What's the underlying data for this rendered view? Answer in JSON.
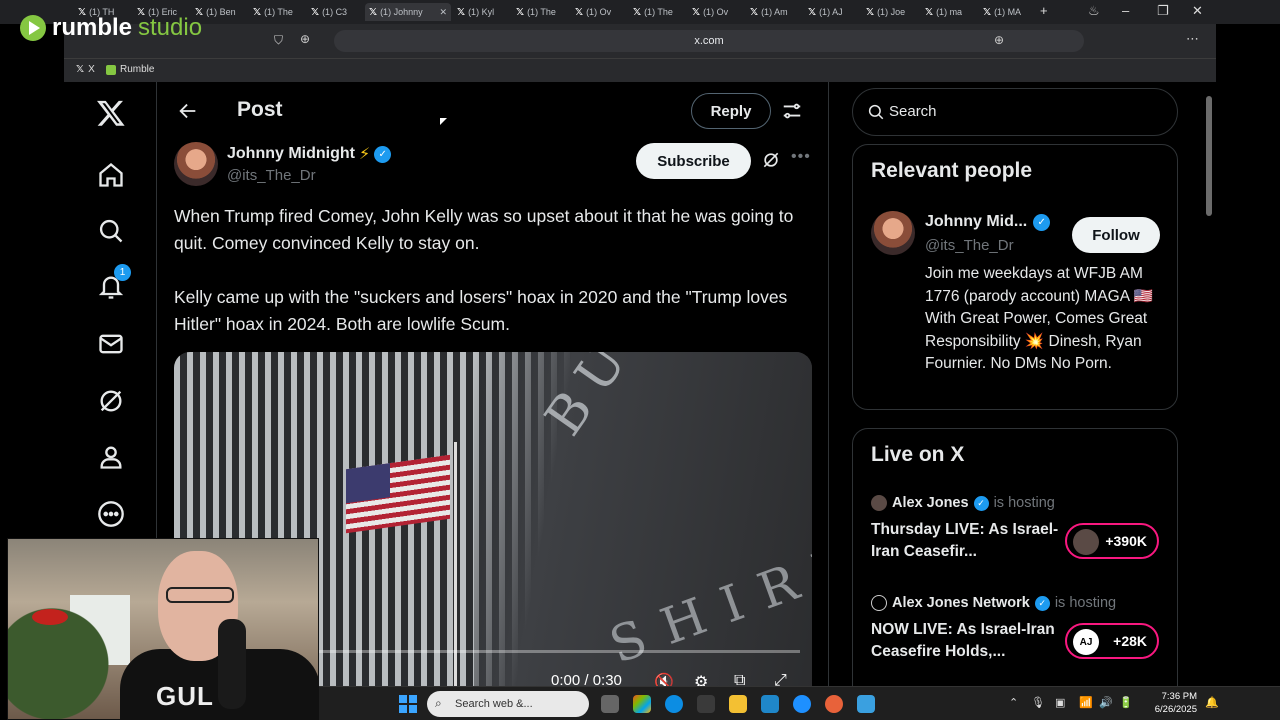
{
  "browser": {
    "tabs": [
      {
        "label": "(1) TH"
      },
      {
        "label": "(1) Eric"
      },
      {
        "label": "(1) Ben"
      },
      {
        "label": "(1) The"
      },
      {
        "label": "(1) C3"
      },
      {
        "label": "(1) Johnny",
        "active": true
      },
      {
        "label": "(1) Kyl"
      },
      {
        "label": "(1) The"
      },
      {
        "label": "(1) Ov"
      },
      {
        "label": "(1) The"
      },
      {
        "label": "(1) Ov"
      },
      {
        "label": "(1) Am"
      },
      {
        "label": "(1) AJ"
      },
      {
        "label": "(1) Joe"
      },
      {
        "label": "(1) ma"
      },
      {
        "label": "(1) MA"
      }
    ],
    "url": "x.com",
    "bookmarks": [
      "X",
      "Rumble"
    ]
  },
  "overlay": {
    "brand": "rumble",
    "brand_suffix": "studio"
  },
  "nav": {
    "notification_count": "1"
  },
  "post": {
    "header_title": "Post",
    "reply_label": "Reply",
    "author_name": "Johnny Midnight",
    "author_emoji": "⚡",
    "author_handle": "@its_The_Dr",
    "subscribe_label": "Subscribe",
    "paragraph_1": "When Trump fired Comey, John Kelly was so upset about it that he was going to quit. Comey convinced Kelly to stay on.",
    "paragraph_2": "Kelly came up with the \"suckers and losers\" hoax in 2020 and the \"Trump loves Hitler\" hoax in 2024. Both are lowlife Scum.",
    "video": {
      "time": "0:00 / 0:30",
      "progress": 0.02,
      "building_text_1": "BUILDING",
      "building_text_2": "SHIRE"
    }
  },
  "sidebar": {
    "search_placeholder": "Search",
    "relevant_title": "Relevant people",
    "person": {
      "name": "Johnny Mid...",
      "handle": "@its_The_Dr",
      "follow_label": "Follow",
      "bio": "Join me weekdays at WFJB AM 1776 (parody account) MAGA 🇺🇸 With Great Power, Comes Great Responsibility 💥 Dinesh, Ryan Fournier. No DMs No Porn."
    },
    "live_title": "Live on X",
    "live_items": [
      {
        "host": "Alex Jones",
        "hosting": "is hosting",
        "title": "Thursday LIVE: As Israel-Iran Ceasefir...",
        "listeners": "+390K"
      },
      {
        "host": "Alex Jones Network",
        "hosting": "is hosting",
        "title": "NOW LIVE: As Israel-Iran Ceasefire Holds,...",
        "listeners": "+28K"
      }
    ]
  },
  "webcam": {
    "shirt_text": "GUL"
  },
  "taskbar": {
    "search_placeholder": "Search web &...",
    "time": "7:36 PM",
    "date": "6/26/2025"
  },
  "colors": {
    "accent": "#1d9bf0",
    "live_pink": "#f91880",
    "rumble_green": "#85c742"
  }
}
